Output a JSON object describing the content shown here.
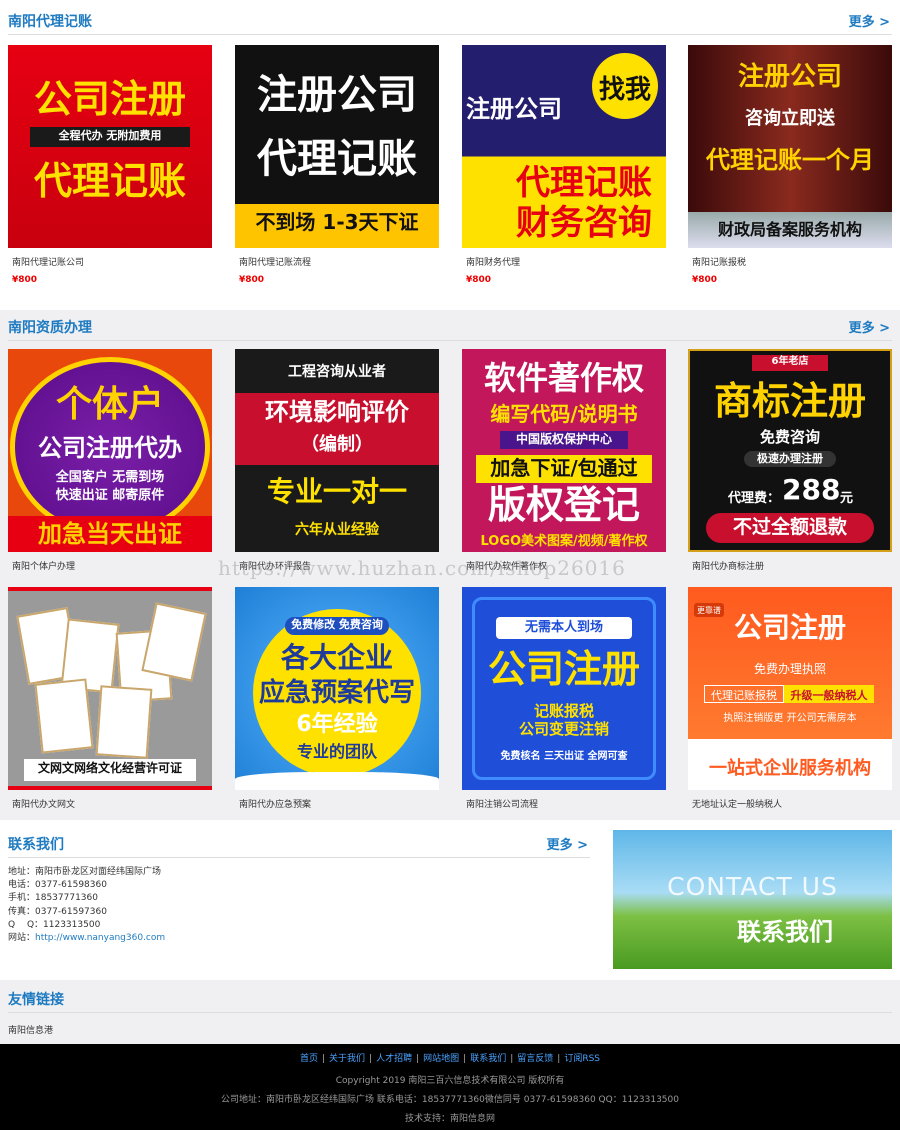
{
  "section1": {
    "title": "南阳代理记账",
    "more": "更多 >",
    "items": [
      {
        "name": "南阳代理记账公司",
        "price": "¥800",
        "img": {
          "l1": "公司注册",
          "l2": "全程代办  无附加费用",
          "l3": "代理记账"
        }
      },
      {
        "name": "南阳代理记账流程",
        "price": "¥800",
        "img": {
          "l1": "注册公司",
          "l2": "代理记账",
          "l3": "不到场 1-3天下证"
        }
      },
      {
        "name": "南阳财务代理",
        "price": "¥800",
        "img": {
          "l1": "注册公司",
          "badge": "找我",
          "l2": "代理记账",
          "l3": "财务咨询"
        }
      },
      {
        "name": "南阳记账报税",
        "price": "¥800",
        "img": {
          "l1": "注册公司",
          "l2": "咨询立即送",
          "l3": "代理记账一个月",
          "l4": "财政局备案服务机构"
        }
      }
    ]
  },
  "section2": {
    "title": "南阳资质办理",
    "more": "更多 >",
    "items": [
      {
        "name": "南阳个体户办理",
        "img": {
          "l1": "个体户",
          "l2": "公司注册代办",
          "l3": "全国客户 无需到场",
          "l4": "快速出证 邮寄原件",
          "l5": "加急当天出证"
        }
      },
      {
        "name": "南阳代办环评报告",
        "img": {
          "l1": "工程咨询从业者",
          "l2": "环境影响评价",
          "l3": "（编制）",
          "l4": "专业一对一",
          "l5": "六年从业经验"
        }
      },
      {
        "name": "南阳代办软件著作权",
        "img": {
          "l1": "软件著作权",
          "l2": "编写代码/说明书",
          "l3": "中国版权保护中心",
          "l4": "加急下证/包通过",
          "l5": "版权登记",
          "l6": "LOGO美术图案/视频/著作权"
        }
      },
      {
        "name": "南阳代办商标注册",
        "img": {
          "l0": "6年老店",
          "l1": "商标注册",
          "l2": "免费咨询",
          "l3": "极速办理注册",
          "l4": "代理费：",
          "l5": "288",
          "l6": "元",
          "l7": "不过全额退款"
        }
      },
      {
        "name": "南阳代办文网文",
        "img": {
          "l1": "文网文网络文化经营许可证"
        }
      },
      {
        "name": "南阳代办应急预案",
        "img": {
          "l1": "免费修改  免费咨询",
          "l2": "各大企业",
          "l3": "应急预案代写",
          "l4": "6年经验",
          "l5": "专业的团队"
        }
      },
      {
        "name": "南阳注销公司流程",
        "img": {
          "l1": "无需本人到场",
          "l2": "公司注册",
          "l3": "记账报税",
          "l4": "公司变更注销",
          "l5": "免费核名   三天出证   全网可查"
        }
      },
      {
        "name": "无地址认定一般纳税人",
        "img": {
          "l0": "更靠谱",
          "l1": "公司注册",
          "l2": "免费办理执照",
          "l3": "代理记账报税",
          "l4": "升级一般纳税人",
          "l5": "执照注销版更  开公司无需房本",
          "l6": "一站式企业服务机构"
        }
      }
    ]
  },
  "contact": {
    "title": "联系我们",
    "more": "更多 >",
    "address": "地址：南阳市卧龙区对面经纬国际广场",
    "phone": "电话：0377-61598360",
    "mobile": "手机：18537771360",
    "fax": "传真：0377-61597360",
    "qq": "Q　 Q：1123313500",
    "site_label": "网站：",
    "site_url": "http://www.nanyang360.com",
    "banner_en": "CONTACT US",
    "banner_cn": "联系我们"
  },
  "links": {
    "title": "友情链接",
    "items": [
      "南阳信息港"
    ]
  },
  "footer": {
    "nav": [
      "首页",
      "关于我们",
      "人才招聘",
      "网站地图",
      "联系我们",
      "留言反馈",
      "订阅RSS"
    ],
    "copyright": "Copyright 2019 南阳三百六信息技术有限公司 版权所有",
    "address": "公司地址：南阳市卧龙区经纬国际广场 联系电话：18537771360微信同号 0377-61598360 QQ：1123313500",
    "support": "技术支持：南阳信息网"
  },
  "watermark": "https://www.huzhan.com/ishop26016",
  "colors": {
    "accent": "#1f7bc1",
    "price": "#ee0000",
    "section_bg": "#f0f0f0",
    "footer_bg": "#000000"
  }
}
